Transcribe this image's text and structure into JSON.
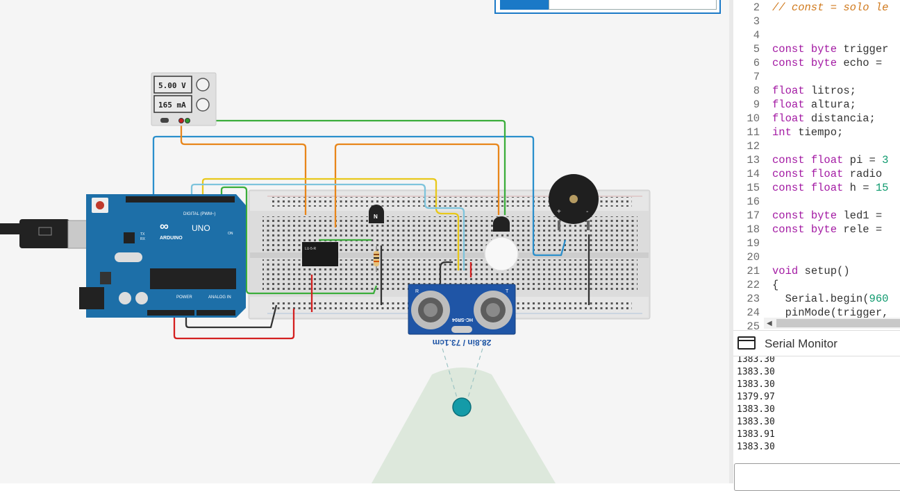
{
  "power_supply": {
    "voltage": "5.00 V",
    "current": "165 mA"
  },
  "arduino": {
    "brand": "ARDUINO",
    "model": "UNO",
    "digital_label": "DIGITAL (PWM~)",
    "power_label": "POWER",
    "analog_label": "ANALOG IN",
    "on_label": "ON",
    "tx_label": "TX",
    "rx_label": "RX"
  },
  "sensor": {
    "model": "HC-SR04",
    "distance_readout": "28.8in / 73.1cm",
    "pin_t": "T",
    "pin_r": "R"
  },
  "relay": {
    "model": "LU-5-R"
  },
  "transistor": {
    "label": "N"
  },
  "buzzer": {
    "plus": "+",
    "minus": "-"
  },
  "code_editor": {
    "lines": [
      {
        "n": "2",
        "segments": [
          {
            "t": "// const = solo le",
            "c": "cm"
          }
        ]
      },
      {
        "n": "3",
        "segments": []
      },
      {
        "n": "4",
        "segments": []
      },
      {
        "n": "5",
        "segments": [
          {
            "t": "const",
            "c": "kw"
          },
          {
            "t": " ",
            "c": ""
          },
          {
            "t": "byte",
            "c": "kw"
          },
          {
            "t": " trigger",
            "c": ""
          }
        ]
      },
      {
        "n": "6",
        "segments": [
          {
            "t": "const",
            "c": "kw"
          },
          {
            "t": " ",
            "c": ""
          },
          {
            "t": "byte",
            "c": "kw"
          },
          {
            "t": " echo =",
            "c": ""
          }
        ]
      },
      {
        "n": "7",
        "segments": []
      },
      {
        "n": "8",
        "segments": [
          {
            "t": "float",
            "c": "kw"
          },
          {
            "t": " litros;",
            "c": ""
          }
        ]
      },
      {
        "n": "9",
        "segments": [
          {
            "t": "float",
            "c": "kw"
          },
          {
            "t": " altura;",
            "c": ""
          }
        ]
      },
      {
        "n": "10",
        "segments": [
          {
            "t": "float",
            "c": "kw"
          },
          {
            "t": " distancia;",
            "c": ""
          }
        ]
      },
      {
        "n": "11",
        "segments": [
          {
            "t": "int",
            "c": "kw"
          },
          {
            "t": " tiempo;",
            "c": ""
          }
        ]
      },
      {
        "n": "12",
        "segments": []
      },
      {
        "n": "13",
        "segments": [
          {
            "t": "const",
            "c": "kw"
          },
          {
            "t": " ",
            "c": ""
          },
          {
            "t": "float",
            "c": "kw"
          },
          {
            "t": " pi = ",
            "c": ""
          },
          {
            "t": "3",
            "c": "nm"
          }
        ]
      },
      {
        "n": "14",
        "segments": [
          {
            "t": "const",
            "c": "kw"
          },
          {
            "t": " ",
            "c": ""
          },
          {
            "t": "float",
            "c": "kw"
          },
          {
            "t": " radio",
            "c": ""
          }
        ]
      },
      {
        "n": "15",
        "segments": [
          {
            "t": "const",
            "c": "kw"
          },
          {
            "t": " ",
            "c": ""
          },
          {
            "t": "float",
            "c": "kw"
          },
          {
            "t": " h = ",
            "c": ""
          },
          {
            "t": "15",
            "c": "nm"
          }
        ]
      },
      {
        "n": "16",
        "segments": []
      },
      {
        "n": "17",
        "segments": [
          {
            "t": "const",
            "c": "kw"
          },
          {
            "t": " ",
            "c": ""
          },
          {
            "t": "byte",
            "c": "kw"
          },
          {
            "t": " led1 =",
            "c": ""
          }
        ]
      },
      {
        "n": "18",
        "segments": [
          {
            "t": "const",
            "c": "kw"
          },
          {
            "t": " ",
            "c": ""
          },
          {
            "t": "byte",
            "c": "kw"
          },
          {
            "t": " rele =",
            "c": ""
          }
        ]
      },
      {
        "n": "19",
        "segments": []
      },
      {
        "n": "20",
        "segments": []
      },
      {
        "n": "21",
        "segments": [
          {
            "t": "void",
            "c": "kw"
          },
          {
            "t": " setup()",
            "c": ""
          }
        ]
      },
      {
        "n": "22",
        "segments": [
          {
            "t": "{",
            "c": ""
          }
        ]
      },
      {
        "n": "23",
        "segments": [
          {
            "t": "  Serial.begin(",
            "c": ""
          },
          {
            "t": "960",
            "c": "nm"
          }
        ]
      },
      {
        "n": "24",
        "segments": [
          {
            "t": "  pinMode(trigger,",
            "c": ""
          }
        ]
      },
      {
        "n": "25",
        "segments": []
      }
    ]
  },
  "serial_monitor": {
    "title": "Serial Monitor",
    "lines": [
      "1383.30",
      "1383.30",
      "1383.30",
      "1379.97",
      "1383.30",
      "1383.30",
      "1383.91",
      "1383.30"
    ]
  },
  "colors": {
    "wire_orange": "#e8861a",
    "wire_green": "#3aad3a",
    "wire_blue": "#2a8fcc",
    "wire_yellow": "#e8c81a",
    "wire_lightblue": "#7ec4dc",
    "wire_red": "#d42020",
    "wire_black": "#333333",
    "arduino_blue": "#1d6fa8",
    "sensor_blue": "#1f55a6",
    "accent": "#1a79c7"
  }
}
